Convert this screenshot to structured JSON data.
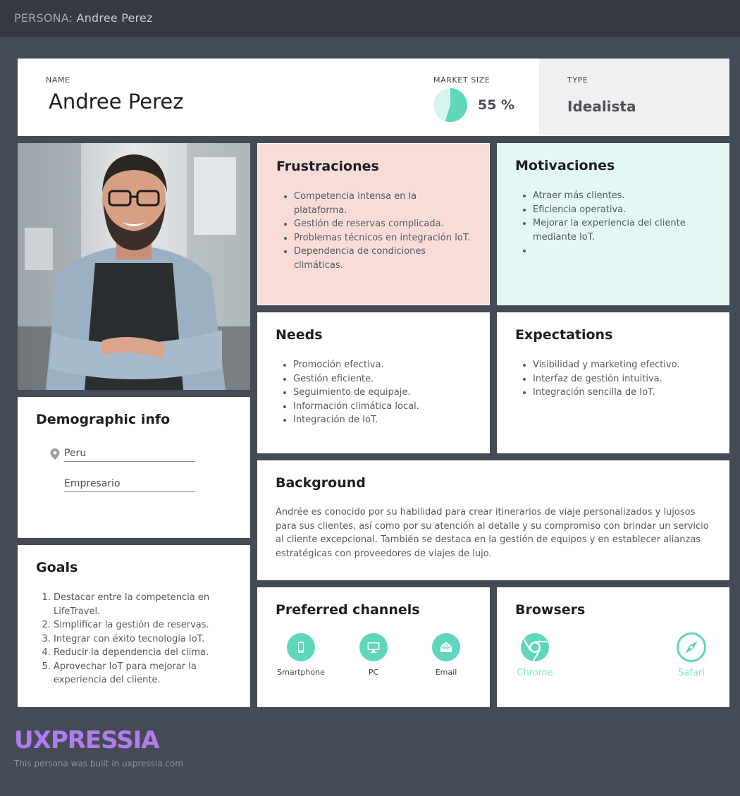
{
  "topbar": {
    "prefix": "PERSONA:",
    "name": "Andree Perez"
  },
  "header": {
    "name_label": "NAME",
    "name": "Andree Perez",
    "market_label": "MARKET SIZE",
    "market_percent": 55,
    "market_value": "55 %",
    "type_label": "TYPE",
    "type": "Idealista"
  },
  "frustrations": {
    "title": "Frustraciones",
    "items": [
      "Competencia intensa en la plataforma.",
      "Gestión de reservas complicada.",
      "Problemas técnicos en integración IoT.",
      "Dependencia de condiciones climáticas."
    ]
  },
  "motivations": {
    "title": "Motivaciones",
    "items": [
      "Atraer más clientes.",
      "Eficiencia operativa.",
      "Mejorar la experiencia del cliente mediante IoT.",
      ""
    ]
  },
  "needs": {
    "title": "Needs",
    "items": [
      "Promoción efectiva.",
      "Gestión eficiente.",
      "Seguimiento de equipaje.",
      "Información climática local.",
      "Integración de IoT."
    ]
  },
  "expectations": {
    "title": "Expectations",
    "items": [
      "Visibilidad y marketing efectivo.",
      "Interfaz de gestión intuitiva.",
      "Integración sencilla de IoT."
    ]
  },
  "demographic": {
    "title": "Demographic info",
    "location": "Peru",
    "occupation": "Empresario"
  },
  "goals": {
    "title": "Goals",
    "items": [
      "Destacar entre la competencia en LifeTravel.",
      "Simplificar la gestión de reservas.",
      "Integrar con éxito tecnología IoT.",
      "Reducir la dependencia del clima.",
      "Aprovechar IoT para mejorar la experiencia del cliente."
    ]
  },
  "background": {
    "title": "Background",
    "text": "Andrée es conocido por su habilidad para crear itinerarios de viaje personalizados y lujosos para sus clientes, así como por su atención al detalle y su compromiso con brindar un servicio al cliente excepcional. También se destaca en la gestión de equipos y en establecer alianzas estratégicas con proveedores de viajes de lujo."
  },
  "channels": {
    "title": "Preferred channels",
    "items": [
      {
        "label": "Smartphone",
        "icon": "smartphone-icon"
      },
      {
        "label": "PC",
        "icon": "monitor-icon"
      },
      {
        "label": "Email",
        "icon": "email-icon"
      }
    ]
  },
  "browsers": {
    "title": "Browsers",
    "items": [
      {
        "label": "Chrome",
        "icon": "chrome-icon"
      },
      {
        "label": "Safari",
        "icon": "safari-icon"
      }
    ]
  },
  "footer": {
    "logo": "UXPRESSIA",
    "note": "This persona was built in uxpressia.com"
  },
  "colors": {
    "accent": "#5ed7bb",
    "frustrations_bg": "#f9dcd8",
    "motivations_bg": "#e3f8f4",
    "logo": "#b07cf0"
  }
}
